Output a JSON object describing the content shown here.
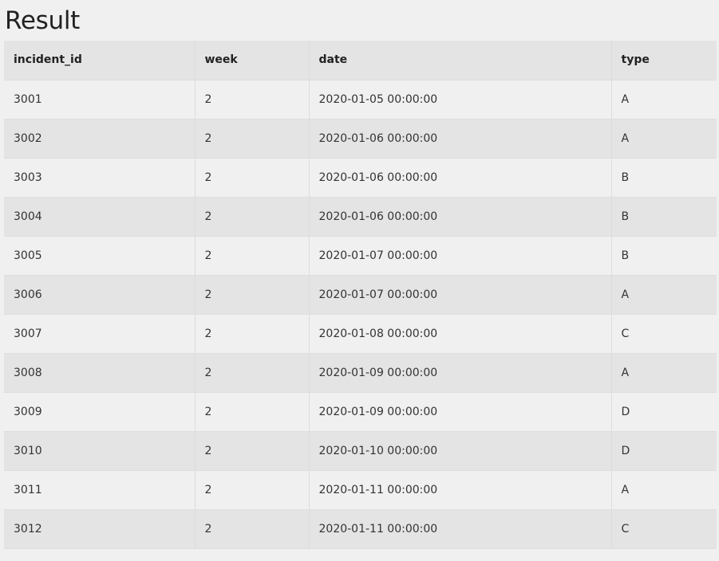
{
  "title": "Result",
  "table": {
    "columns": [
      "incident_id",
      "week",
      "date",
      "type"
    ],
    "rows": [
      [
        "3001",
        "2",
        "2020-01-05 00:00:00",
        "A"
      ],
      [
        "3002",
        "2",
        "2020-01-06 00:00:00",
        "A"
      ],
      [
        "3003",
        "2",
        "2020-01-06 00:00:00",
        "B"
      ],
      [
        "3004",
        "2",
        "2020-01-06 00:00:00",
        "B"
      ],
      [
        "3005",
        "2",
        "2020-01-07 00:00:00",
        "B"
      ],
      [
        "3006",
        "2",
        "2020-01-07 00:00:00",
        "A"
      ],
      [
        "3007",
        "2",
        "2020-01-08 00:00:00",
        "C"
      ],
      [
        "3008",
        "2",
        "2020-01-09 00:00:00",
        "A"
      ],
      [
        "3009",
        "2",
        "2020-01-09 00:00:00",
        "D"
      ],
      [
        "3010",
        "2",
        "2020-01-10 00:00:00",
        "D"
      ],
      [
        "3011",
        "2",
        "2020-01-11 00:00:00",
        "A"
      ],
      [
        "3012",
        "2",
        "2020-01-11 00:00:00",
        "C"
      ]
    ]
  },
  "colors": {
    "background": "#f0f0f0",
    "header_row": "#e4e4e4",
    "row_alt": "#e4e4e4",
    "text": "#222222"
  }
}
